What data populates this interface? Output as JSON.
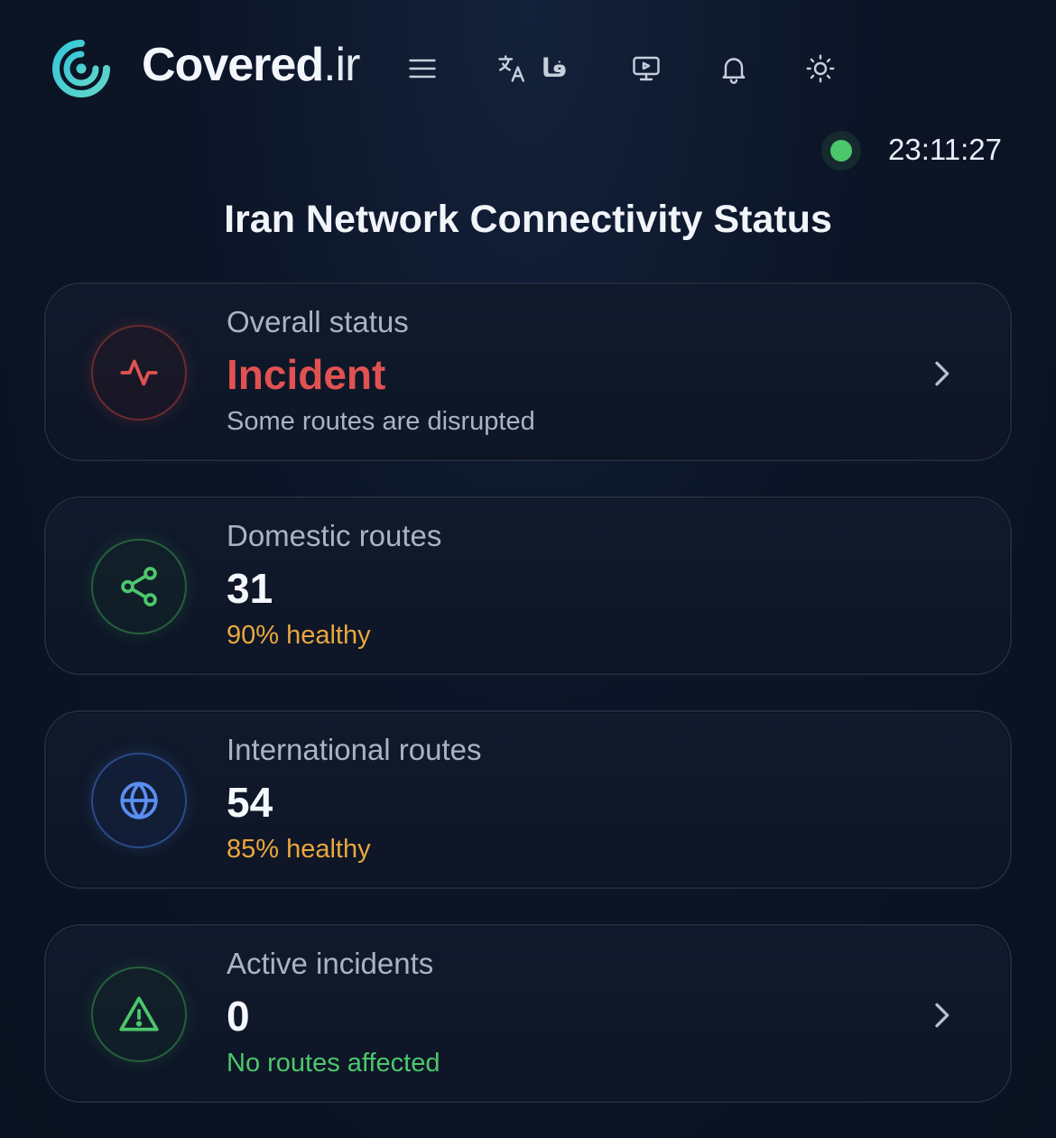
{
  "header": {
    "brand_name": "Covered",
    "brand_tld": ".ir",
    "lang_label": "فا",
    "clock": "23:11:27",
    "connection_status_color": "#4cc76b"
  },
  "page_title": "Iran Network Connectivity Status",
  "cards": [
    {
      "label": "Overall status",
      "value": "Incident",
      "sub": "Some routes are disrupted",
      "icon": "pulse-icon",
      "accent": "#e05252"
    },
    {
      "label": "Domestic routes",
      "value": "31",
      "sub": "90% healthy",
      "icon": "share-icon",
      "accent": "#4cc76b"
    },
    {
      "label": "International routes",
      "value": "54",
      "sub": "85% healthy",
      "icon": "globe-icon",
      "accent": "#5a8ef0"
    },
    {
      "label": "Active incidents",
      "value": "0",
      "sub": "No routes affected",
      "icon": "warning-icon",
      "accent": "#4cc76b"
    }
  ],
  "colors": {
    "background": "#0c1527",
    "incident": "#e05252",
    "healthy_warn": "#e9a83e",
    "ok": "#4cc76b"
  }
}
